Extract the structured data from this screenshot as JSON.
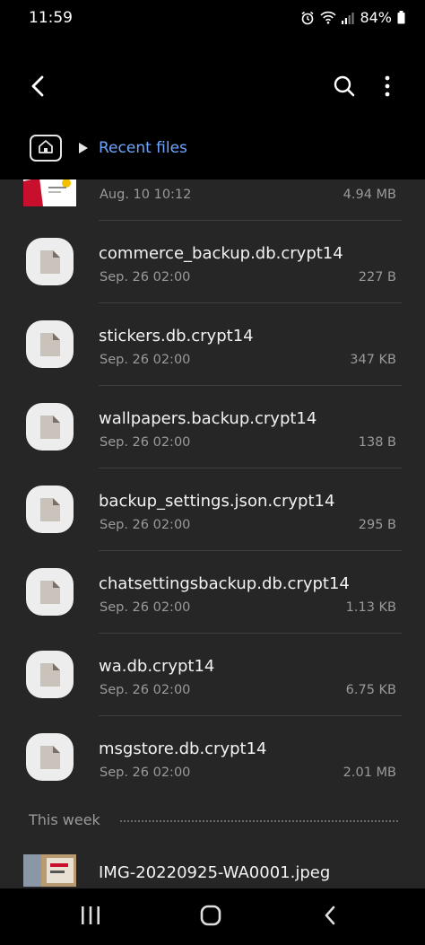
{
  "status_bar": {
    "time": "11:59",
    "battery": "84%",
    "icons": [
      "alarm-icon",
      "wifi-icon",
      "signal-icon",
      "battery-icon"
    ]
  },
  "app_bar": {
    "icons": [
      "chevron-left-icon",
      "search-icon",
      "more-vert-icon"
    ]
  },
  "breadcrumb": {
    "home_icon": "home-icon",
    "current": "Recent files"
  },
  "files_top": [
    {
      "date": "Aug. 10 10:12",
      "size": "4.94 MB",
      "thumbnail": true
    }
  ],
  "files": [
    {
      "name": "commerce_backup.db.crypt14",
      "date": "Sep. 26 02:00",
      "size": "227 B"
    },
    {
      "name": "stickers.db.crypt14",
      "date": "Sep. 26 02:00",
      "size": "347 KB"
    },
    {
      "name": "wallpapers.backup.crypt14",
      "date": "Sep. 26 02:00",
      "size": "138 B"
    },
    {
      "name": "backup_settings.json.crypt14",
      "date": "Sep. 26 02:00",
      "size": "295 B"
    },
    {
      "name": "chatsettingsbackup.db.crypt14",
      "date": "Sep. 26 02:00",
      "size": "1.13 KB"
    },
    {
      "name": "wa.db.crypt14",
      "date": "Sep. 26 02:00",
      "size": "6.75 KB"
    },
    {
      "name": "msgstore.db.crypt14",
      "date": "Sep. 26 02:00",
      "size": "2.01 MB"
    }
  ],
  "section": {
    "title": "This week"
  },
  "files_week": [
    {
      "name": "IMG-20220925-WA0001.jpeg"
    }
  ],
  "colors": {
    "accent": "#6ea6ff",
    "background": "#262626",
    "bar": "#000000",
    "secondary_text": "#9a9a9a"
  },
  "nav_bar": {
    "icons": [
      "recents-icon",
      "home-circle-icon",
      "back-icon"
    ]
  }
}
